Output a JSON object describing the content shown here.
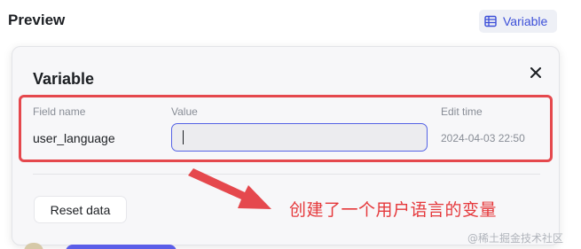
{
  "header": {
    "title": "Preview",
    "variable_chip_label": "Variable"
  },
  "panel": {
    "title": "Variable",
    "columns": {
      "field_name": "Field name",
      "value": "Value",
      "edit_time": "Edit time"
    },
    "row": {
      "field_name": "user_language",
      "value": "",
      "edit_time": "2024-04-03 22:50"
    },
    "reset_label": "Reset data"
  },
  "annotation": "创建了一个用户语言的变量",
  "watermark": "@稀土掘金技术社区",
  "colors": {
    "accent": "#3c4fd8",
    "annotation_red": "#e5484d",
    "input_border": "#5563e5"
  }
}
